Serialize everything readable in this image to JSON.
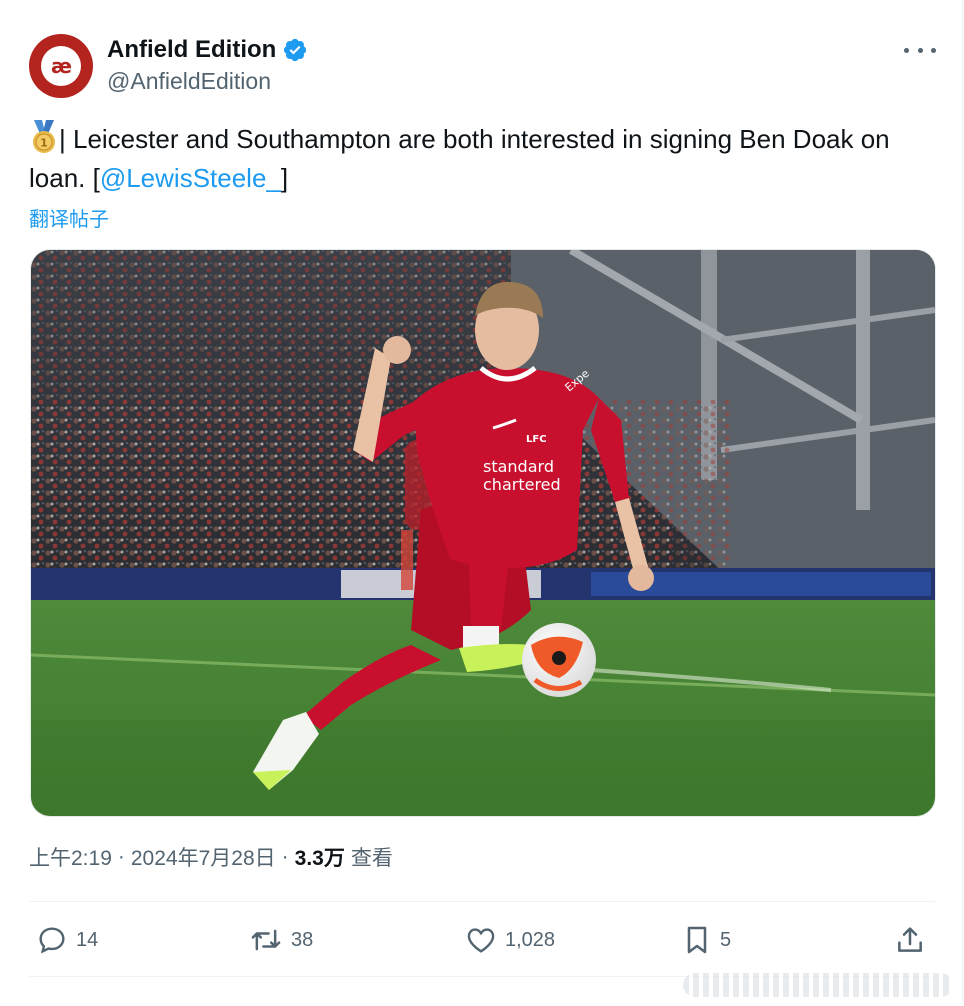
{
  "author": {
    "display_name": "Anfield Edition",
    "handle": "@AnfieldEdition",
    "avatar_text": "æ",
    "verified": true
  },
  "tweet": {
    "text_before": "| Leicester and Southampton are both interested in signing Ben Doak on loan. [",
    "mention": "@LewisSteele_",
    "text_after": "]",
    "leading_icon": "medal-icon",
    "translate_label": "翻译帖子"
  },
  "media": {
    "kit_sponsor_line1": "standard",
    "kit_sponsor_line2": "chartered",
    "kit_crest": "LFC",
    "kit_brand": "Expe"
  },
  "meta": {
    "time": "上午2:19",
    "separator": "·",
    "date": "2024年7月28日",
    "views_count": "3.3万",
    "views_label": "查看"
  },
  "actions": {
    "replies": "14",
    "reposts": "38",
    "likes": "1,028",
    "bookmarks": "5"
  },
  "colors": {
    "accent": "#1d9bf0",
    "text": "#0f1419",
    "secondary": "#536471",
    "avatar_bg": "#b3241f",
    "kit_red": "#c8102e"
  }
}
